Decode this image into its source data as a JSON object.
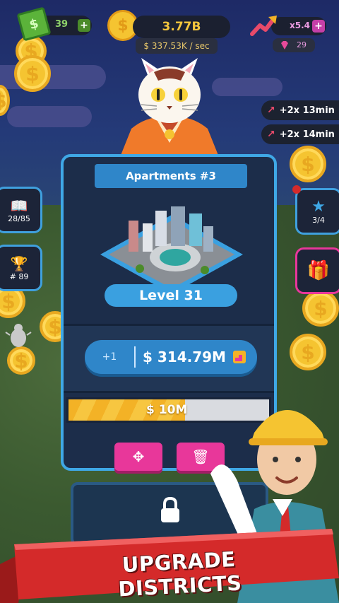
{
  "currency": {
    "gems": "39",
    "money": "3.77B",
    "rate": "$ 337.53K / sec",
    "multiplier": "x5.4",
    "diamonds": "29"
  },
  "boosts": [
    {
      "label": "+2x  13min"
    },
    {
      "label": "+2x  14min"
    }
  ],
  "left_buttons": {
    "book_count": "28/85",
    "trophy_rank": "# 89"
  },
  "right_buttons": {
    "stars": "3/4"
  },
  "panel": {
    "title": "Apartments #3",
    "level": "Level 31",
    "earn_plus": "+1",
    "earn_amount": "$ 314.79M",
    "cost": "$ 10M",
    "cost_progress": 0.58
  },
  "banner": {
    "text": "UPGRADE DISTRICTS"
  },
  "colors": {
    "accent_blue": "#3fa8e6",
    "pink": "#e8379a",
    "gold": "#f5c431",
    "banner_red": "#d42a2a"
  }
}
